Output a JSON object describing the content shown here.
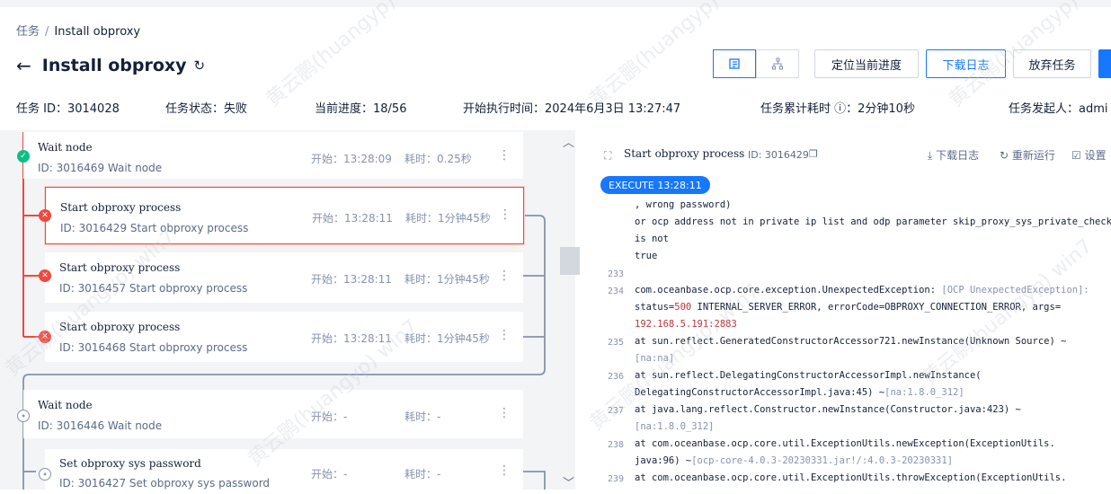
{
  "breadcrumb": {
    "root": "任务",
    "separator": "/",
    "current": "Install obproxy"
  },
  "header": {
    "title": "Install obproxy"
  },
  "toolbar": {
    "locate_label": "定位当前进度",
    "download_log_label": "下载日志",
    "abandon_label": "放弃任务"
  },
  "info": {
    "task_id": "任务 ID：3014028",
    "status": "任务状态：失败",
    "progress": "当前进度：18/56",
    "start_time": "开始执行时间：2024年6月3日 13:27:47",
    "duration": "任务累计耗时 ⓘ：2分钟10秒",
    "initiator": "任务发起人：admi"
  },
  "nodes": [
    {
      "title": "Wait node",
      "sub": "ID: 3016469  Wait node",
      "start": "开始：13:28:09",
      "dur": "耗时：0.25秒",
      "status": "success"
    },
    {
      "title": "Start obproxy process",
      "sub": "ID: 3016429  Start obproxy process",
      "start": "开始：13:28:11",
      "dur": "耗时：1分钟45秒",
      "status": "failed",
      "selected": true
    },
    {
      "title": "Start obproxy process",
      "sub": "ID: 3016457  Start obproxy process",
      "start": "开始：13:28:11",
      "dur": "耗时：1分钟45秒",
      "status": "failed"
    },
    {
      "title": "Start obproxy process",
      "sub": "ID: 3016468  Start obproxy process",
      "start": "开始：13:28:11",
      "dur": "耗时：1分钟45秒",
      "status": "failed"
    },
    {
      "title": "Wait node",
      "sub": "ID: 3016446  Wait node",
      "start": "开始：-",
      "dur": "耗时：-",
      "status": "pending"
    },
    {
      "title": "Set obproxy sys password",
      "sub": "ID: 3016427  Set obproxy sys password",
      "start": "开始：-",
      "dur": "耗时：-",
      "status": "pending"
    }
  ],
  "detail": {
    "title": "Start obproxy process",
    "id": "ID: 3016429",
    "download_log": "下载日志",
    "rerun": "重新运行",
    "settings": "设置",
    "execute_badge": "EXECUTE 13:28:11"
  },
  "log": {
    "lines": [
      {
        "n": "",
        "t": ", wrong password)"
      },
      {
        "n": "",
        "t": " or ocp address not in private ip list and odp parameter skip_proxy_sys_private_check"
      },
      {
        "n": "",
        "t": "is not"
      },
      {
        "n": "",
        "t": "true"
      },
      {
        "n": "233",
        "t": ""
      },
      {
        "n": "234",
        "t": "com.oceanbase.ocp.core.exception.UnexpectedException:",
        "g": " [OCP UnexpectedException]:"
      },
      {
        "n": "",
        "t": " status=",
        "r": "500",
        "t2": " INTERNAL_SERVER_ERROR, errorCode=OBPROXY_CONNECTION_ERROR, args="
      },
      {
        "n": "",
        "r": "192.168.5.191:2883"
      },
      {
        "n": "235",
        "t": "       at sun.reflect.GeneratedConstructorAccessor721.newInstance(Unknown Source) ~"
      },
      {
        "n": "",
        "g": "[na:na]"
      },
      {
        "n": "236",
        "t": "       at sun.reflect.DelegatingConstructorAccessorImpl.newInstance("
      },
      {
        "n": "",
        "t": "DelegatingConstructorAccessorImpl.java:45) ~",
        "g": "[na:1.8.0_312]"
      },
      {
        "n": "237",
        "t": "       at java.lang.reflect.Constructor.newInstance(Constructor.java:423) ~"
      },
      {
        "n": "",
        "g": "[na:1.8.0_312]"
      },
      {
        "n": "238",
        "t": "       at com.oceanbase.ocp.core.util.ExceptionUtils.newException(ExceptionUtils."
      },
      {
        "n": "",
        "t": "java:96) ~",
        "g": "[ocp-core-4.0.3-20230331.jar!/:4.0.3-20230331]"
      },
      {
        "n": "239",
        "t": "       at com.oceanbase.ocp.core.util.ExceptionUtils.throwException(ExceptionUtils."
      }
    ]
  },
  "colors": {
    "accent": "#1677ff",
    "error": "#f0483e",
    "success": "#0ac185",
    "panel_bg": "#f3f4f6"
  },
  "watermark": "黄云鹏(huangyp) win7"
}
